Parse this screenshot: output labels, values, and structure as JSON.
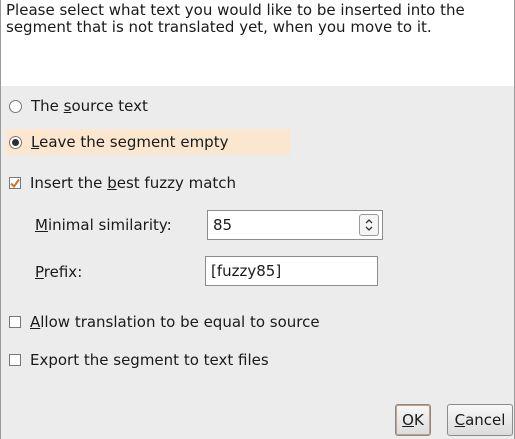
{
  "intro_text": "Please select what text you would like to be inserted into the segment that is not translated yet, when you move to it.",
  "options": {
    "source_text": {
      "before": "The ",
      "key": "s",
      "after": "ource text",
      "selected": false
    },
    "leave_empty": {
      "before": "",
      "key": "L",
      "after": "eave the segment empty",
      "selected": true
    },
    "best_fuzzy": {
      "before": "Insert the ",
      "key": "b",
      "after": "est fuzzy match",
      "checked": true
    }
  },
  "fuzzy": {
    "minimal_similarity_label": {
      "key": "M",
      "after": "inimal similarity:"
    },
    "minimal_similarity_value": "85",
    "prefix_label": {
      "key": "P",
      "after": "refix:"
    },
    "prefix_value": "[fuzzy85]"
  },
  "checkboxes": {
    "allow_equal": {
      "key": "A",
      "after": "llow translation to be equal to source",
      "checked": false
    },
    "export_segment": {
      "label": "Export the segment to text files",
      "checked": false
    }
  },
  "buttons": {
    "ok": {
      "key": "O",
      "after": "K"
    },
    "cancel": {
      "key": "C",
      "after": "ancel"
    }
  },
  "colors": {
    "dialog_bg": "#ececec",
    "selection_highlight": "#fbe7d0",
    "check_mark": "#c2782b"
  }
}
